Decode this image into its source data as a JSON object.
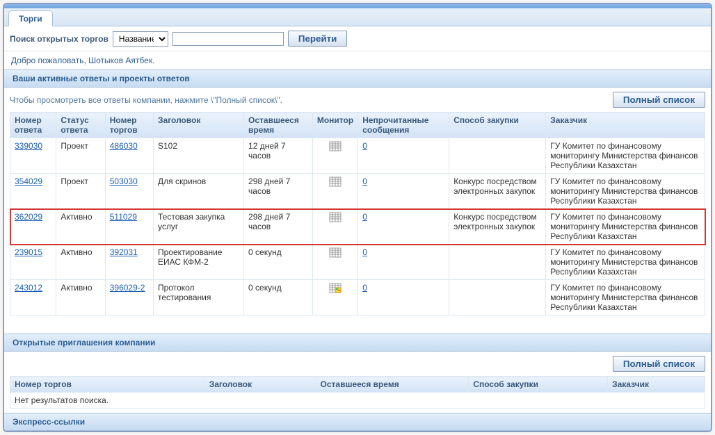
{
  "tab_label": "Торги",
  "search": {
    "label": "Поиск открытых торгов",
    "dropdown_selected": "Название",
    "input_value": "",
    "go_button": "Перейти"
  },
  "welcome": "Добро пожаловать, Шотыков Аятбек.",
  "active_section": {
    "title": "Ваши активные ответы и проекты ответов",
    "hint": "Чтобы просмотреть все ответы компании, нажмите \\\"Полный список\\\".",
    "full_list_button": "Полный список",
    "columns": {
      "resp_no": "Номер ответа",
      "resp_status": "Статус ответа",
      "tender_no": "Номер торгов",
      "title": "Заголовок",
      "time_left": "Оставшееся время",
      "monitor": "Монитор",
      "unread": "Непрочитанные сообщения",
      "purchase": "Способ закупки",
      "customer": "Заказчик"
    },
    "rows": [
      {
        "resp_no": "339030",
        "status": "Проект",
        "tender_no": "486030",
        "title": "S102",
        "time_left": "12 дней 7 часов",
        "monitor": "calendar",
        "unread": "0",
        "purchase": "",
        "customer": "ГУ Комитет по финансовому мониторингу Министерства финансов Республики Казахстан"
      },
      {
        "resp_no": "354029",
        "status": "Проект",
        "tender_no": "503030",
        "title": "Для скринов",
        "time_left": "298 дней 7 часов",
        "monitor": "calendar",
        "unread": "0",
        "purchase": "Конкурс посредством электронных закупок",
        "customer": "ГУ Комитет по финансовому мониторингу Министерства финансов Республики Казахстан"
      },
      {
        "resp_no": "362029",
        "status": "Активно",
        "tender_no": "511029",
        "title": "Тестовая закупка услуг",
        "time_left": "298 дней 7 часов",
        "monitor": "calendar",
        "unread": "0",
        "purchase": "Конкурс посредством электронных закупок",
        "customer": "ГУ Комитет по финансовому мониторингу Министерства финансов Республики Казахстан",
        "highlight": true
      },
      {
        "resp_no": "239015",
        "status": "Активно",
        "tender_no": "392031",
        "title": "Проектирование ЕИАС КФМ-2",
        "time_left": "0 секунд",
        "monitor": "calendar",
        "unread": "0",
        "purchase": "",
        "customer": "ГУ Комитет по финансовому мониторингу Министерства финансов Республики Казахстан"
      },
      {
        "resp_no": "243012",
        "status": "Активно",
        "tender_no": "396029-2",
        "title": "Протокол тестирования",
        "time_left": "0 секунд",
        "monitor": "calendar-flag",
        "unread": "0",
        "purchase": "",
        "customer": "ГУ Комитет по финансовому мониторингу Министерства финансов Республики Казахстан"
      }
    ]
  },
  "invitations_section": {
    "title": "Открытые приглашения компании",
    "full_list_button": "Полный список",
    "columns": {
      "tender_no": "Номер торгов",
      "title": "Заголовок",
      "time_left": "Оставшееся время",
      "purchase": "Способ закупки",
      "customer": "Заказчик"
    },
    "no_results": "Нет результатов поиска."
  },
  "express_section": {
    "title": "Экспресс-ссылки"
  },
  "icons": {
    "calendar": "calendar-icon",
    "calendar_flag": "calendar-flag-icon"
  }
}
